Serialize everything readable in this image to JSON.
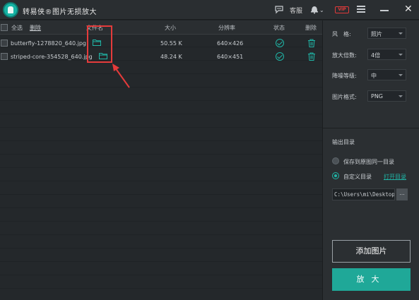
{
  "app": {
    "title": "转易侠®图片无损放大",
    "service_label": "客服",
    "vip_label": "VIP"
  },
  "table": {
    "select_all_label": "全选",
    "delete_label": "删除",
    "headers": {
      "filename": "文件名",
      "size": "大小",
      "resolution": "分辨率",
      "status": "状态",
      "delete": "删除"
    },
    "rows": [
      {
        "filename": "butterfly-1278820_640.jpg",
        "size": "50.55 K",
        "resolution": "640×426"
      },
      {
        "filename": "striped-core-354528_640.jpg",
        "size": "48.24 K",
        "resolution": "640×451"
      }
    ]
  },
  "settings": {
    "style_label": "风　格:",
    "style_value": "照片",
    "scale_label": "放大倍数:",
    "scale_value": "4倍",
    "denoise_label": "降噪等级:",
    "denoise_value": "中",
    "format_label": "图片格式:",
    "format_value": "PNG"
  },
  "output": {
    "section_title": "输出目录",
    "option_same_dir": "保存到原图同一目录",
    "option_custom_dir": "自定义目录",
    "open_dir_link": "打开目录",
    "path_value": "C:\\Users\\mi\\Desktop",
    "browse_label": "..."
  },
  "actions": {
    "add_images": "添加图片",
    "enlarge": "放大"
  },
  "colors": {
    "accent": "#1fa898",
    "highlight": "#e53b3b"
  }
}
